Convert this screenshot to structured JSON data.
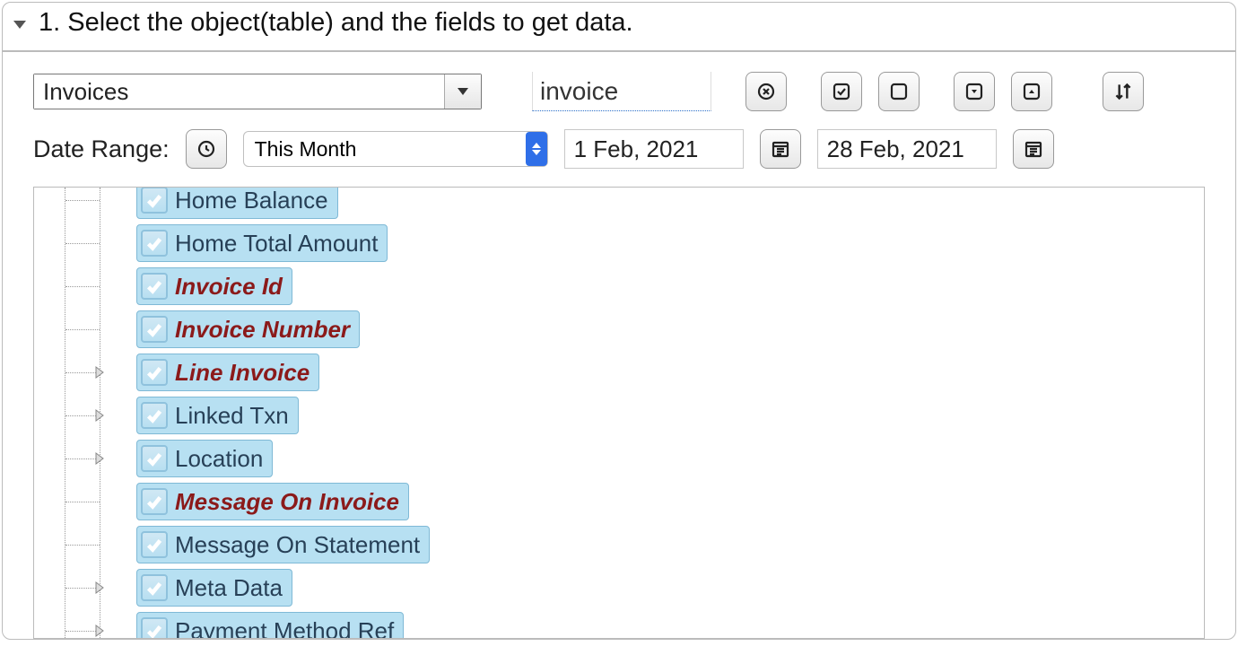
{
  "panel": {
    "title": "1. Select the object(table) and the fields to get data."
  },
  "object_combo": {
    "value": "Invoices"
  },
  "search": {
    "value": "invoice"
  },
  "date_range": {
    "label": "Date Range:",
    "preset": "This Month",
    "from": "1 Feb, 2021",
    "to": "28 Feb, 2021"
  },
  "fields": [
    {
      "label": "Home Balance",
      "highlight": false,
      "expandable": false
    },
    {
      "label": "Home Total Amount",
      "highlight": false,
      "expandable": false
    },
    {
      "label": "Invoice Id",
      "highlight": true,
      "expandable": false
    },
    {
      "label": "Invoice Number",
      "highlight": true,
      "expandable": false
    },
    {
      "label": "Line Invoice",
      "highlight": true,
      "expandable": true
    },
    {
      "label": "Linked Txn",
      "highlight": false,
      "expandable": true
    },
    {
      "label": "Location",
      "highlight": false,
      "expandable": true
    },
    {
      "label": "Message On Invoice",
      "highlight": true,
      "expandable": false
    },
    {
      "label": "Message On Statement",
      "highlight": false,
      "expandable": false
    },
    {
      "label": "Meta Data",
      "highlight": false,
      "expandable": true
    },
    {
      "label": "Payment Method Ref",
      "highlight": false,
      "expandable": true
    }
  ],
  "icons": {
    "clear": "clear-icon",
    "checkall": "check-all-icon",
    "uncheckall": "uncheck-all-icon",
    "expandall": "expand-all-icon",
    "collapseall": "collapse-all-icon",
    "sort": "sort-icon",
    "clock": "clock-icon",
    "calendar": "calendar-icon"
  }
}
